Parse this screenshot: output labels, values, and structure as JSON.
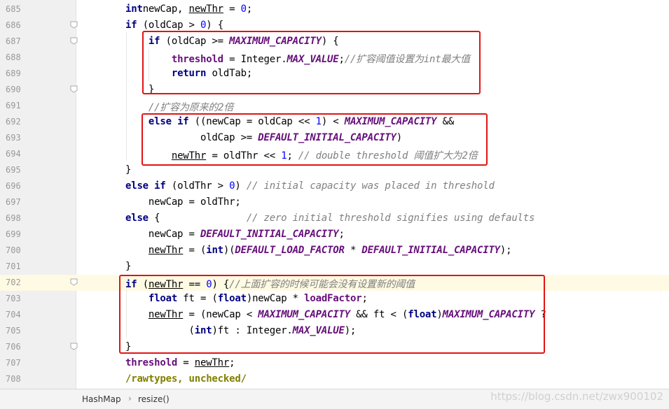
{
  "lines": [
    {
      "n": "685",
      "tokens": [
        [
          "kw",
          "int"
        ],
        [
          "",
          "newCap, "
        ],
        [
          "und",
          "newThr"
        ],
        [
          "",
          " = "
        ],
        [
          "num",
          "0"
        ],
        [
          "",
          ";"
        ]
      ]
    },
    {
      "n": "686",
      "tokens": [
        [
          "kw",
          "if"
        ],
        [
          "",
          " (oldCap > "
        ],
        [
          "num",
          "0"
        ],
        [
          "",
          ") {"
        ]
      ]
    },
    {
      "n": "687",
      "tokens": [
        [
          "",
          "    "
        ],
        [
          "kw",
          "if"
        ],
        [
          "",
          " (oldCap >= "
        ],
        [
          "cst",
          "MAXIMUM_CAPACITY"
        ],
        [
          "",
          ") {"
        ]
      ]
    },
    {
      "n": "688",
      "tokens": [
        [
          "",
          "        "
        ],
        [
          "fld",
          "threshold"
        ],
        [
          "",
          " = Integer."
        ],
        [
          "cst",
          "MAX_VALUE"
        ],
        [
          "",
          ";"
        ],
        [
          "cmt",
          "//扩容阈值设置为int最大值"
        ]
      ]
    },
    {
      "n": "689",
      "tokens": [
        [
          "",
          "        "
        ],
        [
          "kw",
          "return"
        ],
        [
          "",
          " oldTab;"
        ]
      ]
    },
    {
      "n": "690",
      "tokens": [
        [
          "",
          "    }"
        ]
      ]
    },
    {
      "n": "691",
      "tokens": [
        [
          "",
          "    "
        ],
        [
          "cmt",
          "//扩容为原来的2倍"
        ]
      ]
    },
    {
      "n": "692",
      "tokens": [
        [
          "",
          "    "
        ],
        [
          "kw",
          "else if"
        ],
        [
          "",
          " ((newCap = oldCap << "
        ],
        [
          "num",
          "1"
        ],
        [
          "",
          ") < "
        ],
        [
          "cst",
          "MAXIMUM_CAPACITY"
        ],
        [
          "",
          " &&"
        ]
      ]
    },
    {
      "n": "693",
      "tokens": [
        [
          "",
          "             oldCap >= "
        ],
        [
          "cst",
          "DEFAULT_INITIAL_CAPACITY"
        ],
        [
          "",
          ")"
        ]
      ]
    },
    {
      "n": "694",
      "tokens": [
        [
          "",
          "        "
        ],
        [
          "und",
          "newThr"
        ],
        [
          "",
          " = oldThr << "
        ],
        [
          "num",
          "1"
        ],
        [
          "",
          "; "
        ],
        [
          "cmt",
          "// double threshold 阈值扩大为2倍"
        ]
      ]
    },
    {
      "n": "695",
      "tokens": [
        [
          "",
          "}"
        ]
      ]
    },
    {
      "n": "696",
      "tokens": [
        [
          "kw",
          "else if"
        ],
        [
          "",
          " (oldThr > "
        ],
        [
          "num",
          "0"
        ],
        [
          "",
          ") "
        ],
        [
          "cmt",
          "// initial capacity was placed in threshold"
        ]
      ]
    },
    {
      "n": "697",
      "tokens": [
        [
          "",
          "    newCap = oldThr;"
        ]
      ]
    },
    {
      "n": "698",
      "tokens": [
        [
          "kw",
          "else"
        ],
        [
          "",
          " {               "
        ],
        [
          "cmt",
          "// zero initial threshold signifies using defaults"
        ]
      ]
    },
    {
      "n": "699",
      "tokens": [
        [
          "",
          "    newCap = "
        ],
        [
          "cst",
          "DEFAULT_INITIAL_CAPACITY"
        ],
        [
          "",
          ";"
        ]
      ]
    },
    {
      "n": "700",
      "tokens": [
        [
          "",
          "    "
        ],
        [
          "und",
          "newThr"
        ],
        [
          "",
          " = ("
        ],
        [
          "kw",
          "int"
        ],
        [
          "",
          ")("
        ],
        [
          "cst",
          "DEFAULT_LOAD_FACTOR"
        ],
        [
          "",
          " * "
        ],
        [
          "cst",
          "DEFAULT_INITIAL_CAPACITY"
        ],
        [
          "",
          ");"
        ]
      ]
    },
    {
      "n": "701",
      "tokens": [
        [
          "",
          "}"
        ]
      ]
    },
    {
      "n": "702",
      "tokens": [
        [
          "kw",
          "if"
        ],
        [
          "",
          " ("
        ],
        [
          "und",
          "newThr"
        ],
        [
          "",
          " == "
        ],
        [
          "num",
          "0"
        ],
        [
          "",
          ") {"
        ],
        [
          "cmt",
          "//上面扩容的时候可能会没有设置新的阈值"
        ]
      ]
    },
    {
      "n": "703",
      "tokens": [
        [
          "",
          "    "
        ],
        [
          "kw",
          "float"
        ],
        [
          "",
          " ft = ("
        ],
        [
          "kw",
          "float"
        ],
        [
          "",
          ")newCap * "
        ],
        [
          "fld",
          "loadFactor"
        ],
        [
          "",
          ";"
        ]
      ]
    },
    {
      "n": "704",
      "tokens": [
        [
          "",
          "    "
        ],
        [
          "und",
          "newThr"
        ],
        [
          "",
          " = (newCap < "
        ],
        [
          "cst",
          "MAXIMUM_CAPACITY"
        ],
        [
          "",
          " && ft < ("
        ],
        [
          "kw",
          "float"
        ],
        [
          "",
          ")"
        ],
        [
          "cst",
          "MAXIMUM_CAPACITY"
        ],
        [
          "",
          " ?"
        ]
      ]
    },
    {
      "n": "705",
      "tokens": [
        [
          "",
          "           ("
        ],
        [
          "kw",
          "int"
        ],
        [
          "",
          ")ft : Integer."
        ],
        [
          "cst",
          "MAX_VALUE"
        ],
        [
          "",
          ");"
        ]
      ]
    },
    {
      "n": "706",
      "tokens": [
        [
          "",
          "}"
        ]
      ]
    },
    {
      "n": "707",
      "tokens": [
        [
          "fld",
          "threshold"
        ],
        [
          "",
          " = "
        ],
        [
          "und",
          "newThr"
        ],
        [
          "",
          ";"
        ]
      ]
    },
    {
      "n": "708",
      "tokens": [
        [
          "ann",
          "/rawtypes, unchecked/"
        ]
      ]
    }
  ],
  "status": {
    "crumb1": "HashMap",
    "sep": "›",
    "crumb2": "resize()"
  },
  "watermark": "https://blog.csdn.net/zwx900102",
  "colors": {
    "highlight_box": "#e11414",
    "keyword": "#000080",
    "field": "#660e7a",
    "comment": "#808080",
    "number": "#0000ff",
    "current_line": "#fffae3"
  },
  "icons": {
    "fold_marker": "fold-marker-icon"
  }
}
